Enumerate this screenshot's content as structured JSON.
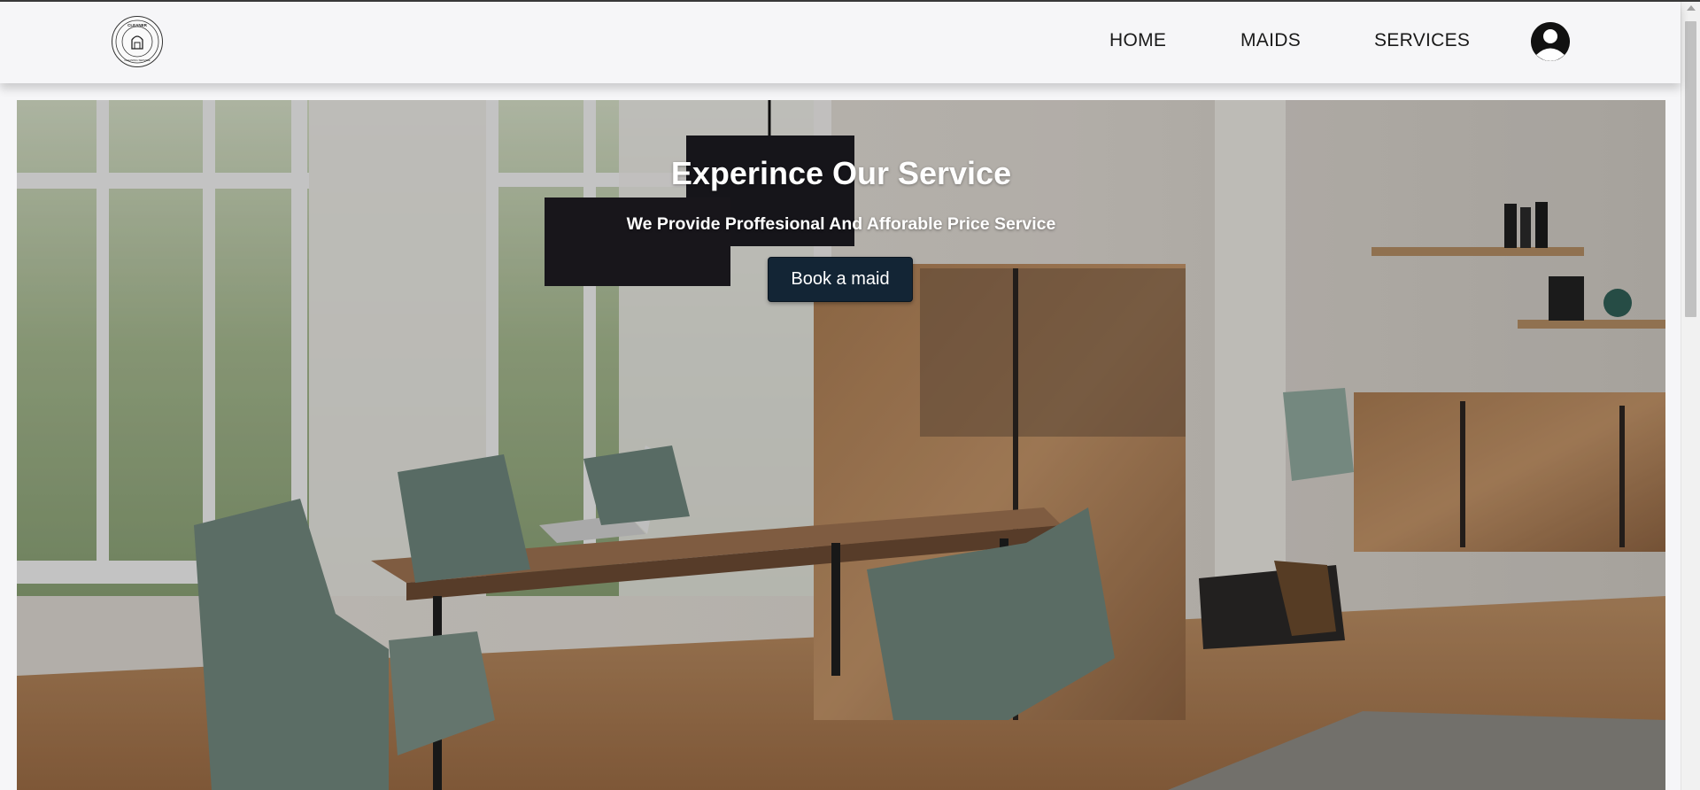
{
  "brand": {
    "logo_text_top": "CLEANER",
    "logo_text_bottom": "CLEANING SERVICE"
  },
  "nav": {
    "items": [
      {
        "label": "HOME"
      },
      {
        "label": "MAIDS"
      },
      {
        "label": "SERVICES"
      }
    ],
    "profile_icon": "user-circle-icon"
  },
  "hero": {
    "title": "Experince Our Service",
    "subtitle": "We Provide Proffesional And Afforable Price Service",
    "cta_label": "Book a maid",
    "background": "dining-room-photo"
  },
  "colors": {
    "navbar_bg": "#f6f6f8",
    "button_bg": "#132535",
    "text_dark": "#1a1a1a"
  }
}
